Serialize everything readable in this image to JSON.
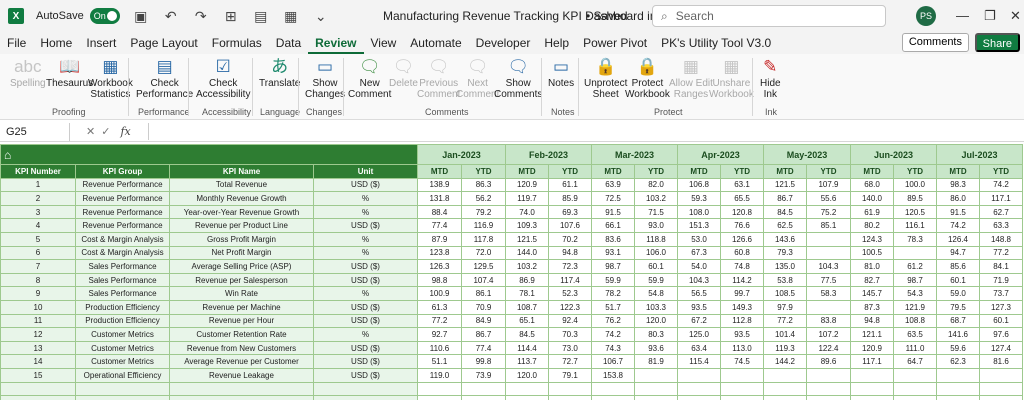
{
  "titlebar": {
    "logo": "X",
    "autosave_label": "AutoSave",
    "autosave_state": "On",
    "doc_title": "Manufacturing Revenue Tracking KPI Dashboard in...",
    "saved_status": "• Saved",
    "search_placeholder": "Search",
    "avatar_initials": "PS"
  },
  "menu": {
    "items": [
      "File",
      "Home",
      "Insert",
      "Page Layout",
      "Formulas",
      "Data",
      "Review",
      "View",
      "Automate",
      "Developer",
      "Help",
      "Power Pivot",
      "PK's Utility Tool V3.0"
    ],
    "active": "Review",
    "comments_label": "Comments",
    "share_label": "Share"
  },
  "ribbon": {
    "buttons": {
      "spelling": "Spelling",
      "thesaurus": "Thesaurus",
      "workbook_stats_1": "Workbook",
      "workbook_stats_2": "Statistics",
      "check_perf_1": "Check",
      "check_perf_2": "Performance",
      "check_access_1": "Check",
      "check_access_2": "Accessibility",
      "translate": "Translate",
      "show_changes_1": "Show",
      "show_changes_2": "Changes",
      "new_comment_1": "New",
      "new_comment_2": "Comment",
      "delete": "Delete",
      "previous_1": "Previous",
      "previous_2": "Comment",
      "next_1": "Next",
      "next_2": "Comment",
      "show_comments_1": "Show",
      "show_comments_2": "Comments",
      "notes": "Notes",
      "unprotect_1": "Unprotect",
      "unprotect_2": "Sheet",
      "protect_wb_1": "Protect",
      "protect_wb_2": "Workbook",
      "allow_edit_1": "Allow Edit",
      "allow_edit_2": "Ranges",
      "unshare_1": "Unshare",
      "unshare_2": "Workbook",
      "hide_ink_1": "Hide",
      "hide_ink_2": "Ink"
    },
    "groups": {
      "proofing": "Proofing",
      "performance": "Performance",
      "accessibility": "Accessibility",
      "language": "Language",
      "changes": "Changes",
      "comments": "Comments",
      "notes": "Notes",
      "protect": "Protect",
      "ink": "Ink"
    }
  },
  "formula_bar": {
    "name_box": "G25",
    "fx_label": "fx"
  },
  "sheet": {
    "headers": [
      "KPI Number",
      "KPI Group",
      "KPI Name",
      "Unit"
    ],
    "months": [
      "Jan-2023",
      "Feb-2023",
      "Mar-2023",
      "Apr-2023",
      "May-2023",
      "Jun-2023",
      "Jul-2023"
    ],
    "sub_headers": [
      "MTD",
      "YTD"
    ],
    "rows": [
      {
        "n": "1",
        "group": "Revenue Performance",
        "name": "Total Revenue",
        "unit": "USD ($)",
        "vals": [
          "138.9",
          "86.3",
          "120.9",
          "61.1",
          "63.9",
          "82.0",
          "106.8",
          "63.1",
          "121.5",
          "107.9",
          "68.0",
          "100.0",
          "98.3",
          "74.2"
        ]
      },
      {
        "n": "2",
        "group": "Revenue Performance",
        "name": "Monthly Revenue Growth",
        "unit": "%",
        "vals": [
          "131.8",
          "56.2",
          "119.7",
          "85.9",
          "72.5",
          "103.2",
          "59.3",
          "65.5",
          "86.7",
          "55.6",
          "140.0",
          "89.5",
          "86.0",
          "117.1"
        ]
      },
      {
        "n": "3",
        "group": "Revenue Performance",
        "name": "Year-over-Year Revenue Growth",
        "unit": "%",
        "vals": [
          "88.4",
          "79.2",
          "74.0",
          "69.3",
          "91.5",
          "71.5",
          "108.0",
          "120.8",
          "84.5",
          "75.2",
          "61.9",
          "120.5",
          "91.5",
          "62.7"
        ]
      },
      {
        "n": "4",
        "group": "Revenue Performance",
        "name": "Revenue per Product Line",
        "unit": "USD ($)",
        "vals": [
          "77.4",
          "116.9",
          "109.3",
          "107.6",
          "66.1",
          "93.0",
          "151.3",
          "76.6",
          "62.5",
          "85.1",
          "80.2",
          "116.1",
          "74.2",
          "63.3"
        ]
      },
      {
        "n": "5",
        "group": "Cost & Margin Analysis",
        "name": "Gross Profit Margin",
        "unit": "%",
        "vals": [
          "87.9",
          "117.8",
          "121.5",
          "70.2",
          "83.6",
          "118.8",
          "53.0",
          "126.6",
          "143.6",
          "",
          "124.3",
          "78.3",
          "126.4",
          "148.8"
        ]
      },
      {
        "n": "6",
        "group": "Cost & Margin Analysis",
        "name": "Net Profit Margin",
        "unit": "%",
        "vals": [
          "123.8",
          "72.0",
          "144.0",
          "94.8",
          "93.1",
          "106.0",
          "67.3",
          "60.8",
          "79.3",
          "",
          "100.5",
          "",
          "94.7",
          "77.2"
        ]
      },
      {
        "n": "7",
        "group": "Sales Performance",
        "name": "Average Selling Price (ASP)",
        "unit": "USD ($)",
        "vals": [
          "126.3",
          "129.5",
          "103.2",
          "72.3",
          "98.7",
          "60.1",
          "54.0",
          "74.8",
          "135.0",
          "104.3",
          "81.0",
          "61.2",
          "85.6",
          "84.1"
        ]
      },
      {
        "n": "8",
        "group": "Sales Performance",
        "name": "Revenue per Salesperson",
        "unit": "USD ($)",
        "vals": [
          "98.8",
          "107.4",
          "86.9",
          "117.4",
          "59.9",
          "59.9",
          "104.3",
          "114.2",
          "53.8",
          "77.5",
          "82.7",
          "98.7",
          "60.1",
          "71.9"
        ]
      },
      {
        "n": "9",
        "group": "Sales Performance",
        "name": "Win Rate",
        "unit": "%",
        "vals": [
          "100.9",
          "86.1",
          "78.1",
          "52.3",
          "78.2",
          "54.8",
          "56.5",
          "99.7",
          "108.5",
          "58.3",
          "145.7",
          "54.3",
          "59.0",
          "73.7"
        ]
      },
      {
        "n": "10",
        "group": "Production Efficiency",
        "name": "Revenue per Machine",
        "unit": "USD ($)",
        "vals": [
          "61.3",
          "70.9",
          "108.7",
          "122.3",
          "51.7",
          "103.3",
          "93.5",
          "149.3",
          "97.9",
          "",
          "87.3",
          "121.9",
          "79.5",
          "127.3"
        ]
      },
      {
        "n": "11",
        "group": "Production Efficiency",
        "name": "Revenue per Hour",
        "unit": "USD ($)",
        "vals": [
          "77.2",
          "84.9",
          "65.1",
          "92.4",
          "76.2",
          "120.0",
          "67.2",
          "112.8",
          "77.2",
          "83.8",
          "94.8",
          "108.8",
          "68.7",
          "60.1"
        ]
      },
      {
        "n": "12",
        "group": "Customer Metrics",
        "name": "Customer Retention Rate",
        "unit": "%",
        "vals": [
          "92.7",
          "86.7",
          "84.5",
          "70.3",
          "74.2",
          "80.3",
          "125.0",
          "93.5",
          "101.4",
          "107.2",
          "121.1",
          "63.5",
          "141.6",
          "97.6"
        ]
      },
      {
        "n": "13",
        "group": "Customer Metrics",
        "name": "Revenue from New Customers",
        "unit": "USD ($)",
        "vals": [
          "110.6",
          "77.4",
          "114.4",
          "73.0",
          "74.3",
          "93.6",
          "63.4",
          "113.0",
          "119.3",
          "122.4",
          "120.9",
          "111.0",
          "59.6",
          "127.4"
        ]
      },
      {
        "n": "14",
        "group": "Customer Metrics",
        "name": "Average Revenue per Customer",
        "unit": "USD ($)",
        "vals": [
          "51.1",
          "99.8",
          "113.7",
          "72.7",
          "106.7",
          "81.9",
          "115.4",
          "74.5",
          "144.2",
          "89.6",
          "117.1",
          "64.7",
          "62.3",
          "81.6"
        ]
      },
      {
        "n": "15",
        "group": "Operational Efficiency",
        "name": "Revenue Leakage",
        "unit": "USD ($)",
        "vals": [
          "119.0",
          "73.9",
          "120.0",
          "79.1",
          "153.8",
          "",
          "",
          "",
          "",
          "",
          "",
          "",
          "",
          ""
        ]
      }
    ]
  },
  "colors": {
    "excel_green": "#107c41",
    "header_green": "#2e7d32",
    "light_green": "#c8e6c9",
    "row_green": "#e8f5e9"
  }
}
